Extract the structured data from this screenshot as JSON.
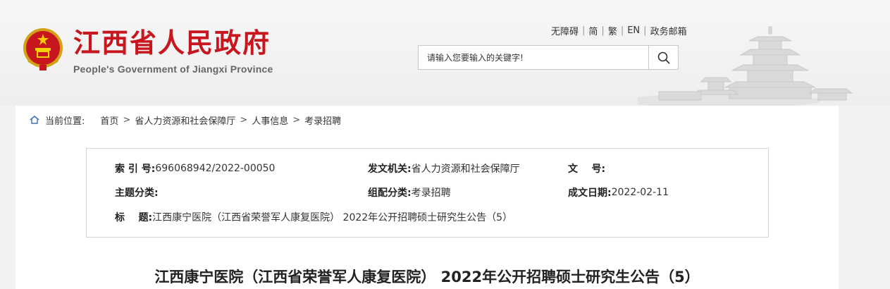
{
  "header": {
    "title": "江西省人民政府",
    "subtitle": "People's Government of Jiangxi Province",
    "links": [
      "无障碍",
      "简",
      "繁",
      "EN",
      "政务邮箱"
    ],
    "search_placeholder": "请输入您要输入的关键字!",
    "emblem_icon": "national-emblem-icon",
    "search_icon": "search-icon",
    "accent_color": "#c7161d"
  },
  "breadcrumb": {
    "label": "当前位置:",
    "items": [
      "首页",
      "省人力资源和社会保障厅",
      "人事信息",
      "考录招聘"
    ],
    "separator": ">"
  },
  "meta": {
    "index_label": "索 引 号:",
    "index_value": "696068942/2022-00050",
    "issuer_label": "发文机关:",
    "issuer_value": "省人力资源和社会保障厅",
    "doc_no_label": "文    号:",
    "doc_no_value": "",
    "topic_label": "主题分类:",
    "topic_value": "",
    "category_label": "组配分类:",
    "category_value": "考录招聘",
    "date_label": "成文日期:",
    "date_value": "2022-02-11",
    "title_label": "标    题:",
    "title_value": "江西康宁医院（江西省荣誉军人康复医院） 2022年公开招聘硕士研究生公告（5）"
  },
  "article": {
    "title": "江西康宁医院（江西省荣誉军人康复医院） 2022年公开招聘硕士研究生公告（5）"
  }
}
